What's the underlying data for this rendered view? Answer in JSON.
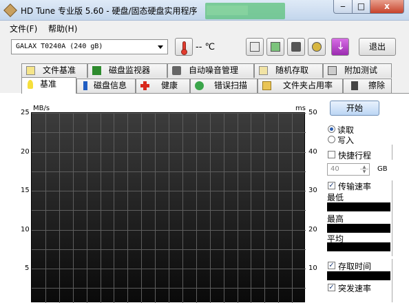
{
  "window": {
    "title": "HD Tune 专业版 5.60 - 硬盘/固态硬盘实用程序",
    "min": "‒",
    "max": "□",
    "close": "x"
  },
  "menu": {
    "file": "文件(F)",
    "help": "帮助(H)"
  },
  "toolbar": {
    "drive": "GALAX   T0240A (240 gB)",
    "temperature": "-- ℃",
    "exit": "退出"
  },
  "tabs_top": [
    {
      "label": "文件基准"
    },
    {
      "label": "磁盘监视器"
    },
    {
      "label": "自动噪音管理"
    },
    {
      "label": "随机存取"
    },
    {
      "label": "附加测试"
    }
  ],
  "tabs_bottom": [
    {
      "label": "基准"
    },
    {
      "label": "磁盘信息"
    },
    {
      "label": "健康"
    },
    {
      "label": "错误扫描"
    },
    {
      "label": "文件夹占用率"
    },
    {
      "label": "擦除"
    }
  ],
  "chart_data": {
    "type": "line",
    "left_axis": {
      "unit": "MB/s",
      "ticks": [
        "25",
        "20",
        "15",
        "10",
        "5"
      ]
    },
    "right_axis": {
      "unit": "ms",
      "ticks": [
        "50",
        "40",
        "30",
        "20",
        "10"
      ]
    },
    "series": []
  },
  "side": {
    "start": "开始",
    "read": "读取",
    "write": "写入",
    "shortstroke": "快捷行程",
    "shortstroke_value": "40",
    "gb": "GB",
    "transfer_rate": "传输速率",
    "min": "最低",
    "max": "最高",
    "avg": "平均",
    "access_time": "存取时间",
    "burst_rate": "突发速率"
  }
}
